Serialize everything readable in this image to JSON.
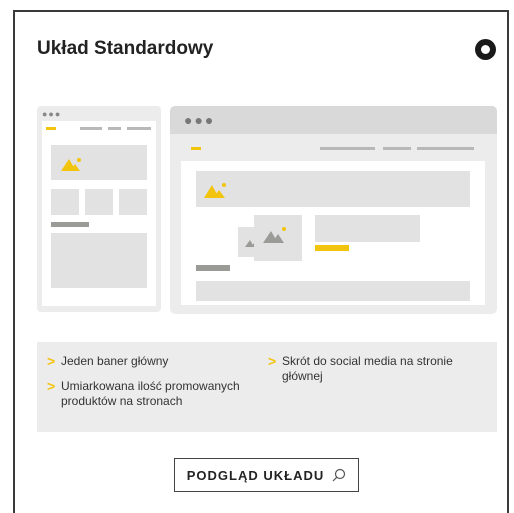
{
  "layout": {
    "title": "Układ Standardowy",
    "selected": true
  },
  "highlights": [
    "Jeden baner główny",
    "Umiarkowana ilość promowanych produktów na stronach",
    "Skrót do social media na stronie głównej"
  ],
  "preview_button": {
    "label": "PODGLĄD UKŁADU",
    "icon": "search-icon"
  },
  "colors": {
    "accent": "#f2c40e",
    "placeholder_gray": "#e2e2e2",
    "frame_gray": "#ececec",
    "dark": "#1a1a1a"
  }
}
